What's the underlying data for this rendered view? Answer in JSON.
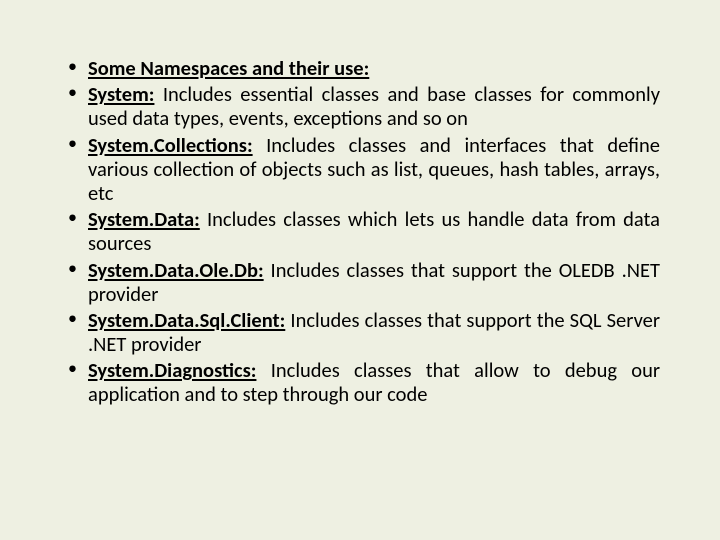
{
  "bullets": [
    {
      "label": "Some Namespaces and their use:",
      "desc": ""
    },
    {
      "label": "System:",
      "desc": " Includes essential classes and base classes for commonly used data types, events, exceptions and so on"
    },
    {
      "label": "System.Collections:",
      "desc": " Includes classes and interfaces that define various collection of objects such as list, queues, hash tables, arrays, etc"
    },
    {
      "label": "System.Data:",
      "desc": " Includes classes which lets us handle data from data sources"
    },
    {
      "label": "System.Data.Ole.Db:",
      "desc": " Includes classes that support the OLEDB .NET provider"
    },
    {
      "label": "System.Data.Sql.Client:",
      "desc": " Includes classes that support the SQL Server .NET provider"
    },
    {
      "label": "System.Diagnostics:",
      "desc": " Includes classes that allow to debug our application and to step through our code"
    }
  ]
}
